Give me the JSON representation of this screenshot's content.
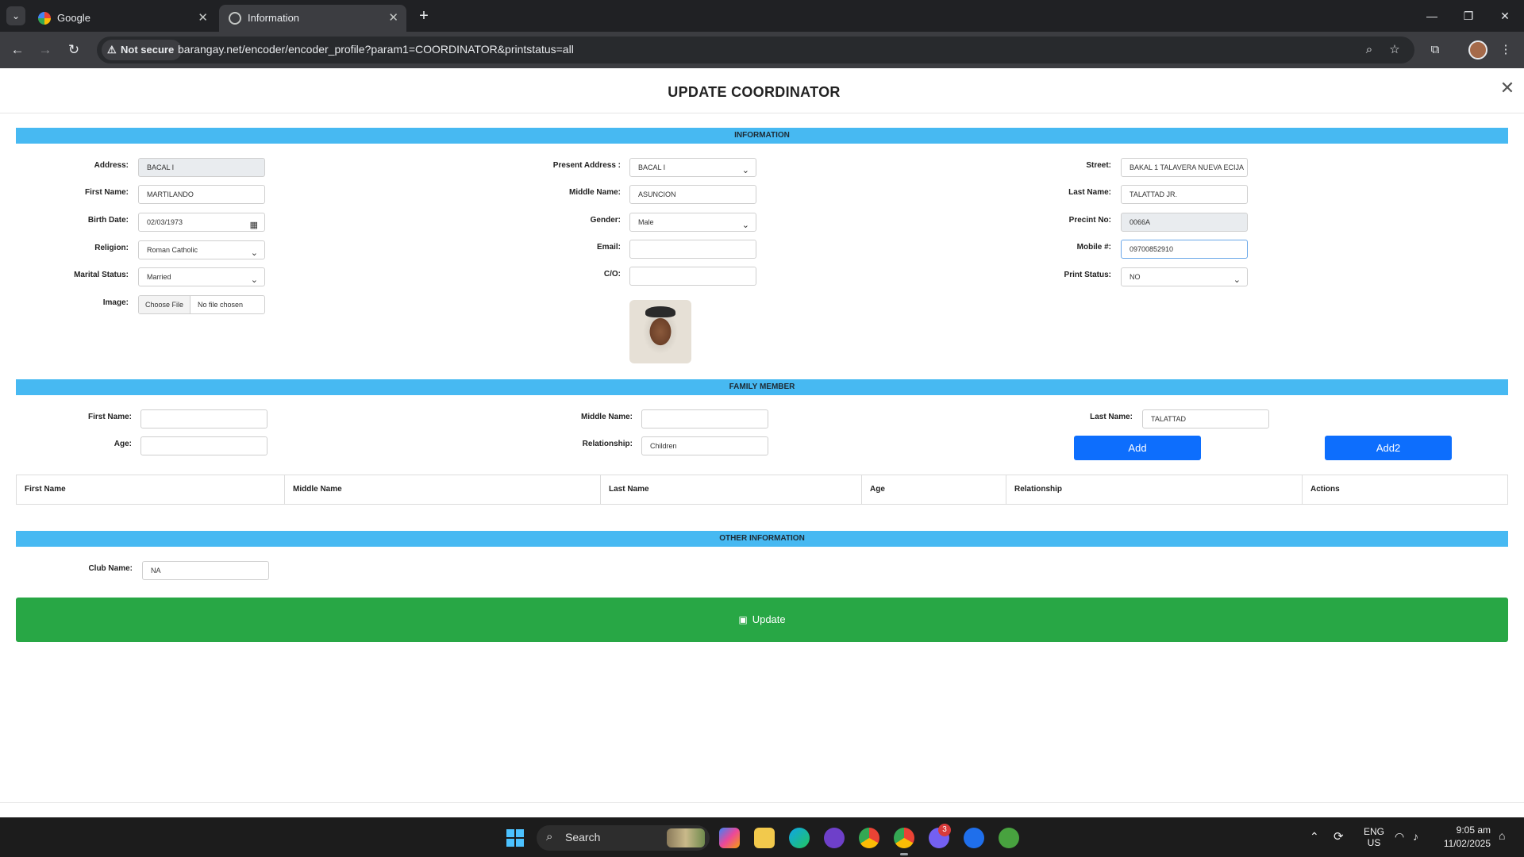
{
  "browser": {
    "tabs": [
      {
        "title": "Google"
      },
      {
        "title": "Information"
      }
    ],
    "security_label": "Not secure",
    "url": "barangay.net/encoder/encoder_profile?param1=COORDINATOR&printstatus=all"
  },
  "modal": {
    "title": "UPDATE COORDINATOR"
  },
  "info_section": {
    "header": "INFORMATION",
    "col1": {
      "address": {
        "label": "Address:",
        "value": "BACAL I"
      },
      "first_name": {
        "label": "First Name:",
        "value": "MARTILANDO"
      },
      "birth_date": {
        "label": "Birth Date:",
        "value": "02/03/1973"
      },
      "religion": {
        "label": "Religion:",
        "value": "Roman Catholic"
      },
      "marital_status": {
        "label": "Marital Status:",
        "value": "Married"
      },
      "image": {
        "label": "Image:",
        "button": "Choose File",
        "status": "No file chosen"
      }
    },
    "col2": {
      "present_address": {
        "label": "Present Address :",
        "value": "BACAL I"
      },
      "middle_name": {
        "label": "Middle Name:",
        "value": "ASUNCION"
      },
      "gender": {
        "label": "Gender:",
        "value": "Male"
      },
      "email": {
        "label": "Email:",
        "value": ""
      },
      "co": {
        "label": "C/O:",
        "value": ""
      }
    },
    "col3": {
      "street": {
        "label": "Street:",
        "value": "BAKAL 1  TALAVERA NUEVA ECIJA"
      },
      "last_name": {
        "label": "Last Name:",
        "value": "TALATTAD JR."
      },
      "precinct_no": {
        "label": "Precint No:",
        "value": "0066A"
      },
      "mobile": {
        "label": "Mobile #:",
        "value": "09700852910"
      },
      "print_status": {
        "label": "Print Status:",
        "value": "NO"
      }
    }
  },
  "family_section": {
    "header": "FAMILY MEMBER",
    "first_name": {
      "label": "First Name:",
      "value": ""
    },
    "age": {
      "label": "Age:",
      "value": ""
    },
    "middle_name": {
      "label": "Middle Name:",
      "value": ""
    },
    "relationship": {
      "label": "Relationship:",
      "value": "Children"
    },
    "last_name": {
      "label": "Last Name:",
      "value": "TALATTAD"
    },
    "add_label": "Add",
    "add2_label": "Add2",
    "table_headers": [
      "First Name",
      "Middle Name",
      "Last Name",
      "Age",
      "Relationship",
      "Actions"
    ]
  },
  "other_section": {
    "header": "OTHER INFORMATION",
    "club_name": {
      "label": "Club Name:",
      "value": "NA"
    }
  },
  "update_label": "Update",
  "taskbar": {
    "search_label": "Search",
    "lang_top": "ENG",
    "lang_bottom": "US",
    "time": "9:05 am",
    "date": "11/02/2025",
    "viber_badge": "3"
  },
  "colors": {
    "section_bar": "#47b9f2",
    "primary_button": "#0d6efd",
    "update_button": "#28a745"
  }
}
